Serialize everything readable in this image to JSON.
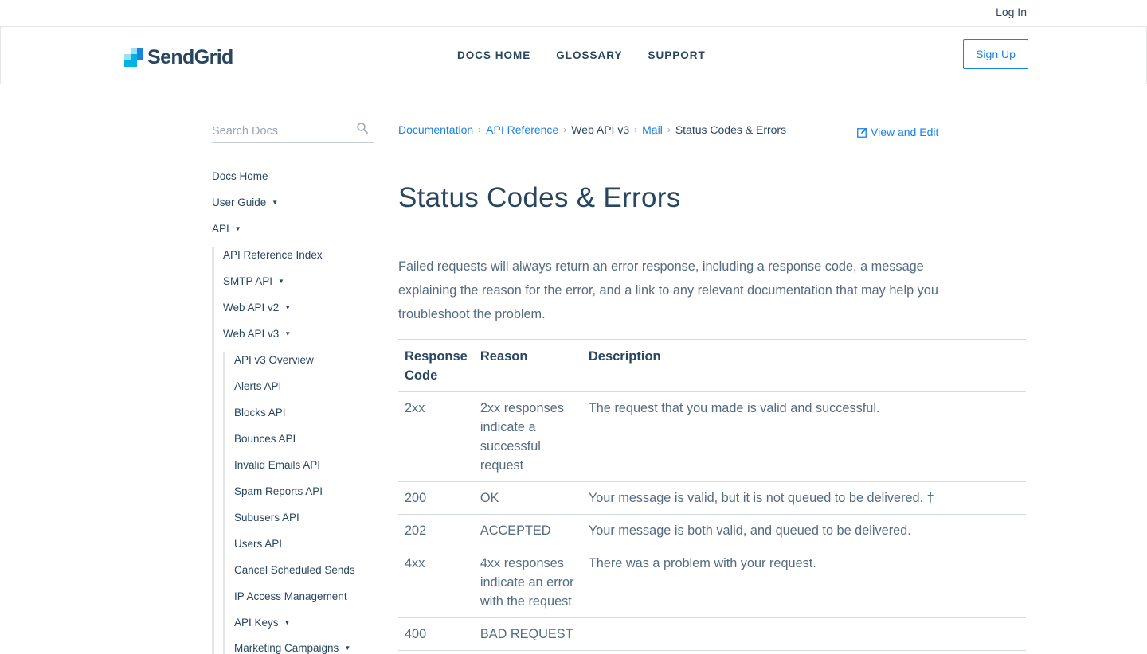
{
  "topbar": {
    "login": "Log In"
  },
  "header": {
    "brand": "SendGrid",
    "nav": [
      "DOCS HOME",
      "GLOSSARY",
      "SUPPORT"
    ],
    "signup": "Sign Up"
  },
  "search": {
    "placeholder": "Search Docs"
  },
  "sidebar": {
    "docs_home": "Docs Home",
    "user_guide": "User Guide",
    "api": "API",
    "api_reference_index": "API Reference Index",
    "smtp_api": "SMTP API",
    "web_api_v2": "Web API v2",
    "web_api_v3": "Web API v3",
    "v3_items": [
      "API v3 Overview",
      "Alerts API",
      "Blocks API",
      "Bounces API",
      "Invalid Emails API",
      "Spam Reports API",
      "Subusers API",
      "Users API",
      "Cancel Scheduled Sends",
      "IP Access Management",
      "API Keys",
      "Marketing Campaigns"
    ]
  },
  "breadcrumb": {
    "documentation": "Documentation",
    "api_reference": "API Reference",
    "web_api_v3": "Web API v3",
    "mail": "Mail",
    "current": "Status Codes & Errors"
  },
  "view_edit": "View and Edit",
  "page": {
    "title": "Status Codes & Errors",
    "intro": "Failed requests will always return an error response, including a response code, a message explaining the reason for the error, and a link to any relevant documentation that may help you troubleshoot the problem."
  },
  "table": {
    "headers": [
      "Response Code",
      "Reason",
      "Description"
    ],
    "rows": [
      {
        "code": "2xx",
        "reason": "2xx responses indicate a successful request",
        "description": "The request that you made is valid and successful."
      },
      {
        "code": "200",
        "reason": "OK",
        "description": "Your message is valid, but it is not queued to be delivered. †"
      },
      {
        "code": "202",
        "reason": "ACCEPTED",
        "description": "Your message is both valid, and queued to be delivered."
      },
      {
        "code": "4xx",
        "reason": "4xx responses indicate an error with the request",
        "description": "There was a problem with your request."
      },
      {
        "code": "400",
        "reason": "BAD REQUEST",
        "description": ""
      }
    ]
  },
  "colors": {
    "brand_dark": "#294661",
    "link": "#1a82e2",
    "logo_light": "#99e1f4",
    "logo_mid": "#00b3e3",
    "logo_dark": "#1a82e2"
  }
}
